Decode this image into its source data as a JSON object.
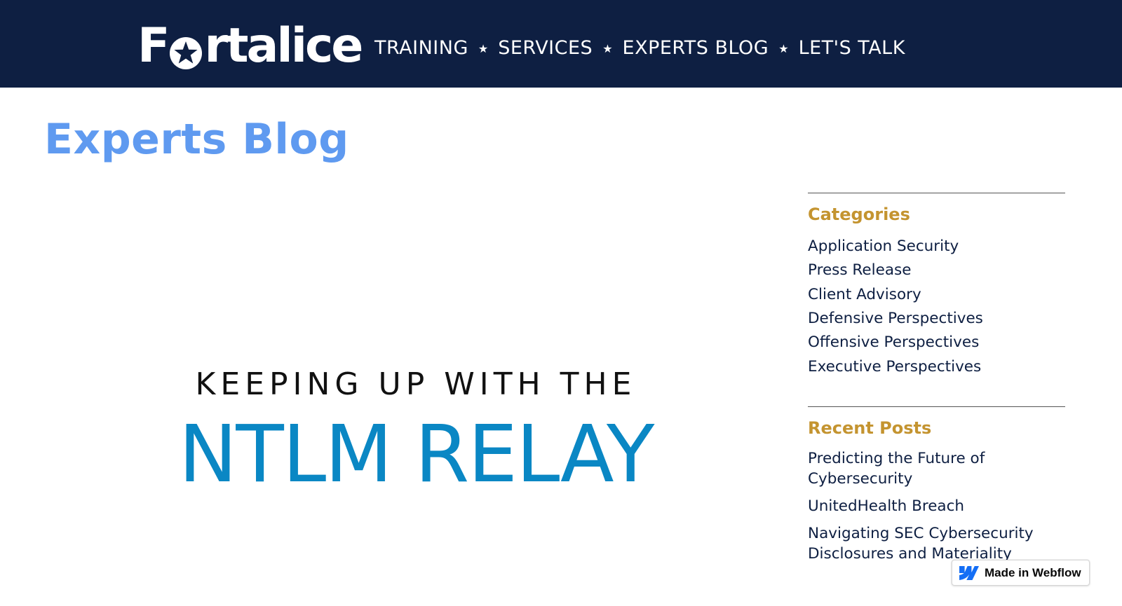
{
  "header": {
    "logo_text_before": "F",
    "logo_text_after": "rtalice",
    "nav": [
      {
        "label": "TRAINING"
      },
      {
        "label": "SERVICES"
      },
      {
        "label": "EXPERTS BLOG"
      },
      {
        "label": "LET'S TALK"
      }
    ],
    "separator": "★"
  },
  "page": {
    "title": "Experts Blog"
  },
  "featured_post": {
    "kicker": "KEEPING UP WITH THE",
    "headline": "NTLM RELAY"
  },
  "sidebar": {
    "categories_heading": "Categories",
    "categories": [
      {
        "label": "Application Security"
      },
      {
        "label": "Press Release"
      },
      {
        "label": "Client Advisory"
      },
      {
        "label": "Defensive Perspectives"
      },
      {
        "label": "Offensive Perspectives"
      },
      {
        "label": "Executive Perspectives"
      }
    ],
    "recent_heading": "Recent Posts",
    "recent_posts": [
      {
        "label": "Predicting the Future of Cybersecurity"
      },
      {
        "label": "UnitedHealth Breach"
      },
      {
        "label": "Navigating SEC Cybersecurity Disclosures and Materiality"
      }
    ]
  },
  "badge": {
    "label": "Made in Webflow"
  },
  "colors": {
    "header_bg": "#0e1f42",
    "title_blue": "#5f9af0",
    "heading_gold": "#c49430",
    "link_navy": "#0e1f42",
    "headline_blue": "#0a87c4",
    "webflow_blue": "#146ef5"
  },
  "icons": {
    "logo_star": "star-icon",
    "nav_separator": "star-separator-icon",
    "badge_logo": "webflow-logo-icon"
  }
}
